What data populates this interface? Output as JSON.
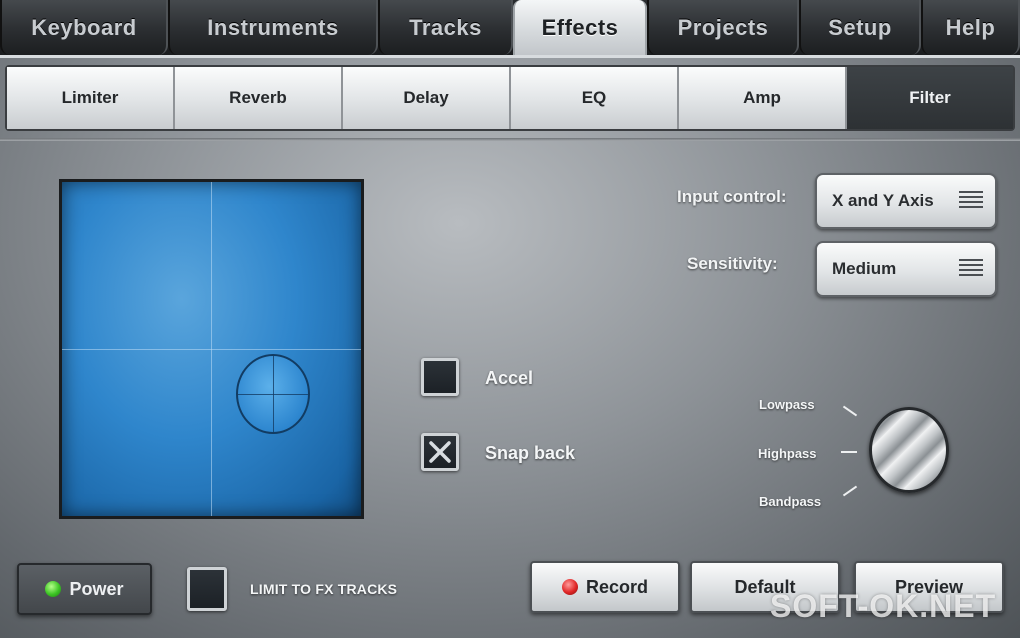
{
  "top_tabs": {
    "keyboard": "Keyboard",
    "instruments": "Instruments",
    "tracks": "Tracks",
    "effects": "Effects",
    "projects": "Projects",
    "setup": "Setup",
    "help": "Help",
    "active": "Effects"
  },
  "effect_tabs": {
    "limiter": "Limiter",
    "reverb": "Reverb",
    "delay": "Delay",
    "eq": "EQ",
    "amp": "Amp",
    "filter": "Filter",
    "active": "Filter"
  },
  "controls": {
    "input_control_label": "Input control:",
    "input_control_value": "X and Y Axis",
    "sensitivity_label": "Sensitivity:",
    "sensitivity_value": "Medium"
  },
  "checkboxes": {
    "accel_label": "Accel",
    "accel_checked": false,
    "snap_back_label": "Snap back",
    "snap_back_checked": true,
    "limit_label": "LIMIT TO FX TRACKS",
    "limit_checked": false
  },
  "filter_knob": {
    "lowpass": "Lowpass",
    "highpass": "Highpass",
    "bandpass": "Bandpass"
  },
  "buttons": {
    "power": "Power",
    "record": "Record",
    "default": "Default",
    "preview": "Preview"
  },
  "watermark": "SOFT-OK.NET",
  "colors": {
    "pad_blue": "#2f86cc",
    "power_led": "#3cc524",
    "record_led": "#e02626"
  }
}
